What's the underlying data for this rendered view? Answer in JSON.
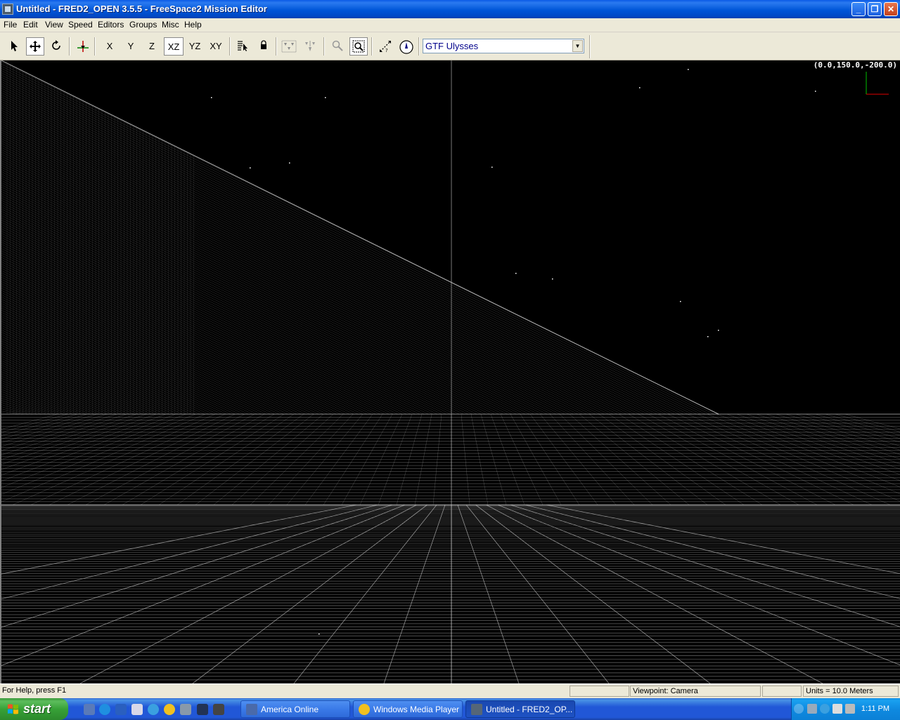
{
  "window": {
    "title": "Untitled - FRED2_OPEN 3.5.5 - FreeSpace2 Mission Editor",
    "minimize": "_",
    "restore": "❐",
    "close": "✕"
  },
  "menu": [
    "File",
    "Edit",
    "View",
    "Speed",
    "Editors",
    "Groups",
    "Misc",
    "Help"
  ],
  "toolbar": {
    "axis_buttons": [
      "X",
      "Y",
      "Z",
      "XZ",
      "YZ",
      "XY"
    ],
    "pressed_axis": "XZ",
    "ship_select": {
      "value": "GTF Ulysses"
    }
  },
  "viewport": {
    "coords": "(0.0,150.0,-200.0)",
    "background": "#000000",
    "grid_color": "#c8c8c8"
  },
  "status": {
    "help": "For Help, press F1",
    "viewpoint": "Viewpoint: Camera",
    "units": "Units = 10.0 Meters"
  },
  "taskbar": {
    "start": "start",
    "tasks": [
      {
        "label": "America  Online"
      },
      {
        "label": "Windows Media Player"
      },
      {
        "label": "Untitled - FRED2_OP..."
      }
    ],
    "clock": "1:11 PM"
  }
}
